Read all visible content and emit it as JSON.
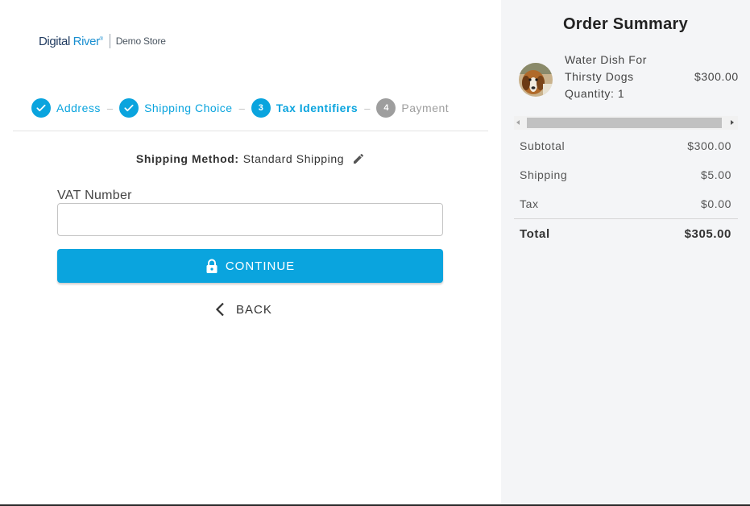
{
  "brand": {
    "logo_part1": "Digital",
    "logo_part2": " River",
    "logo_reg": "®",
    "store_name": "Demo Store"
  },
  "stepper": {
    "steps": [
      {
        "label": "Address",
        "state": "completed",
        "icon": "check-icon"
      },
      {
        "label": "Shipping Choice",
        "state": "completed",
        "icon": "check-icon"
      },
      {
        "label": "Tax Identifiers",
        "number": "3",
        "state": "active"
      },
      {
        "label": "Payment",
        "number": "4",
        "state": "inactive"
      }
    ],
    "separator": "–"
  },
  "shipping_method": {
    "label": "Shipping Method:",
    "value": "Standard Shipping",
    "edit_icon": "pencil-icon"
  },
  "vat": {
    "label": "VAT Number",
    "value": "",
    "placeholder": ""
  },
  "actions": {
    "continue_label": "CONTINUE",
    "continue_icon": "lock-icon",
    "back_label": "BACK",
    "back_icon": "chevron-left-icon"
  },
  "order_summary": {
    "title": "Order Summary",
    "item": {
      "name_line1": "Water Dish For",
      "name_line2": "Thirsty Dogs",
      "quantity": "Quantity: 1",
      "price": "$300.00"
    },
    "subtotal": {
      "label": "Subtotal",
      "value": "$300.00"
    },
    "shipping": {
      "label": "Shipping",
      "value": "$5.00"
    },
    "tax": {
      "label": "Tax",
      "value": "$0.00"
    },
    "total": {
      "label": "Total",
      "value": "$305.00"
    }
  },
  "colors": {
    "accent": "#0aa4de",
    "inactive": "#9e9e9e",
    "summary_bg": "#f4f5f7"
  }
}
